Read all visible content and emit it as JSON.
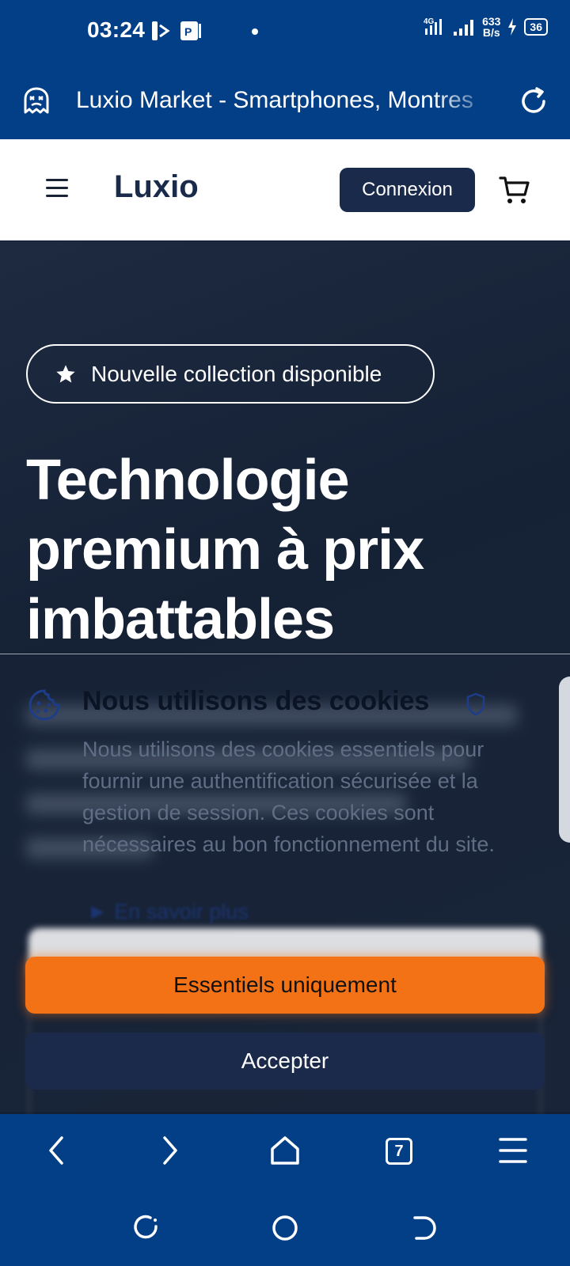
{
  "status_bar": {
    "time": "03:24",
    "network_speed_value": "633",
    "network_speed_unit": "B/s",
    "network_type": "4G",
    "battery": "36"
  },
  "browser": {
    "page_title": "Luxio Market - Smartphones, Montres",
    "tab_count": "7"
  },
  "site_header": {
    "brand": "Luxio",
    "login_label": "Connexion"
  },
  "hero": {
    "badge_text": "Nouvelle collection disponible",
    "title_line1": "Technologie",
    "title_line2": "premium à prix",
    "title_line3": "imbattables"
  },
  "cookie_banner": {
    "title": "Nous utilisons des cookies",
    "description": "Nous utilisons des cookies essentiels pour fournir une authentification sécurisée et la gestion de session. Ces cookies sont nécessaires au bon fonctionnement du site.",
    "learn_more": "► En savoir plus",
    "essential_button": "Essentiels uniquement",
    "accept_button": "Accepter"
  },
  "colors": {
    "browser_chrome": "#033f86",
    "brand_navy": "#1a2a4a",
    "accent_orange": "#f47216"
  },
  "icons": {
    "address_left": "ghost-icon",
    "address_right": "reload-icon",
    "header_left": "menu-icon",
    "header_right": "cart-icon",
    "badge": "star-icon",
    "cookie": "cookie-icon",
    "cookie_title_suffix": "shield-icon",
    "toolbar": [
      "back-icon",
      "forward-icon",
      "home-icon",
      "tabs-icon",
      "menu-icon"
    ],
    "system_nav": [
      "recents-icon",
      "home-circle-icon",
      "back-icon"
    ]
  }
}
